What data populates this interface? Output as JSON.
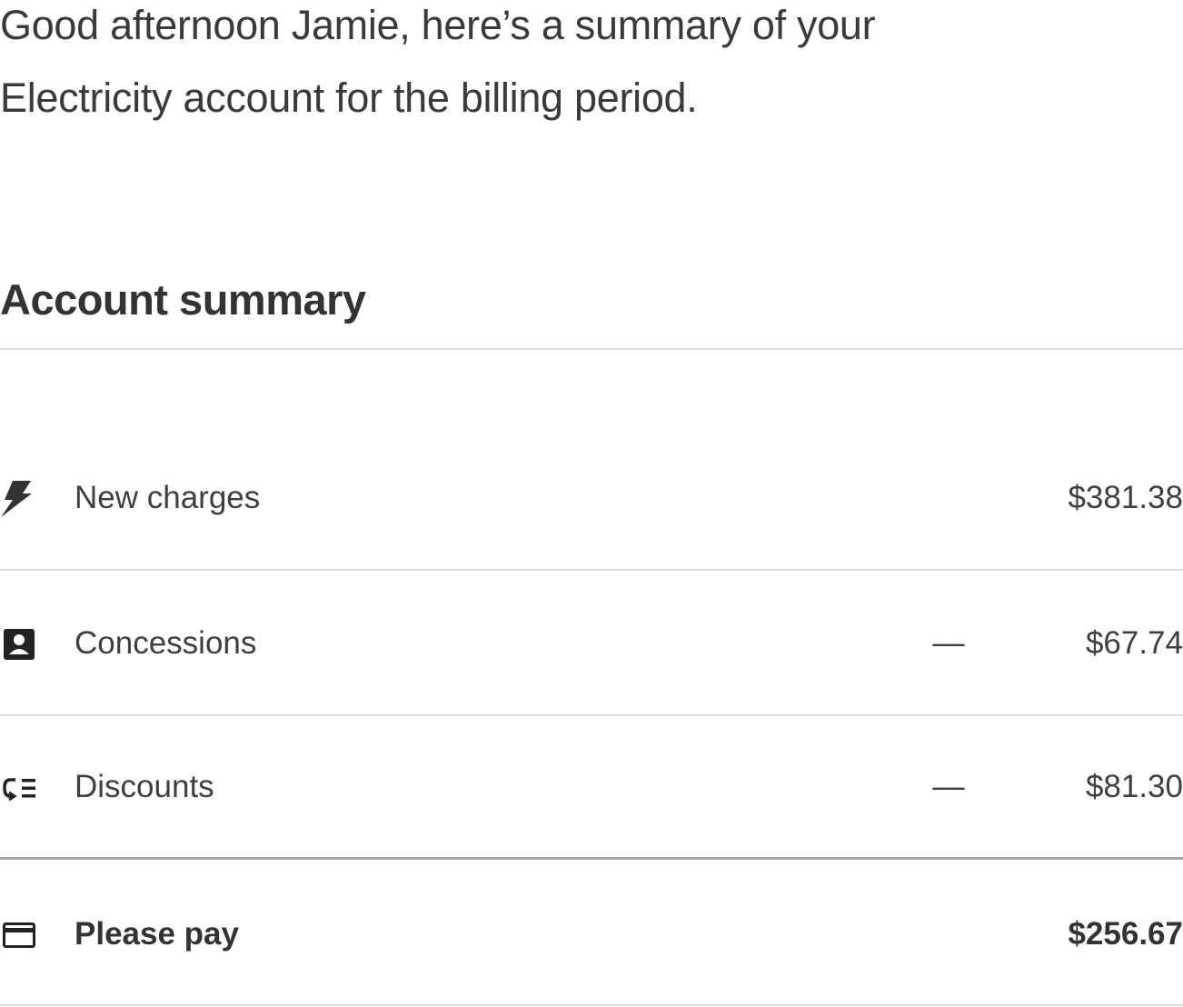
{
  "greeting": {
    "line1": "Good afternoon Jamie, here’s a summary of your",
    "line2": "Electricity account for the billing period."
  },
  "summary": {
    "title": "Account summary",
    "rows": [
      {
        "icon": "lightning-bolt-icon",
        "label": "New charges",
        "sign": "",
        "amount": "$381.38"
      },
      {
        "icon": "contact-card-icon",
        "label": "Concessions",
        "sign": "—",
        "amount": "$67.74"
      },
      {
        "icon": "discount-list-icon",
        "label": "Discounts",
        "sign": "—",
        "amount": "$81.30"
      }
    ],
    "total": {
      "icon": "credit-card-icon",
      "label": "Please pay",
      "amount": "$256.67"
    }
  },
  "colors": {
    "text": "#3c3c3c",
    "heading": "#333333",
    "divider": "#d9d9d9",
    "divider_strong": "#a6a6a6"
  }
}
